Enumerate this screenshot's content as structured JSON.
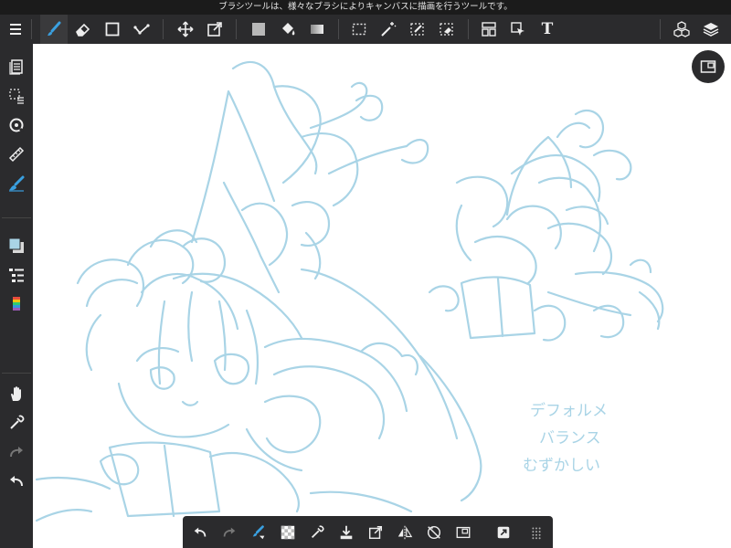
{
  "hint_bar": {
    "text": "ブラシツールは、様々なブラシによりキャンバスに描画を行うツールです。"
  },
  "toolbar": {
    "menu_icon": "menu-icon",
    "tools": [
      "brush-tool",
      "eraser-tool",
      "shape-tool",
      "correction-tool",
      "move-tool",
      "transform-tool",
      "fill-color",
      "bucket-tool",
      "gradation-tool",
      "selection-tool",
      "magic-wand-tool",
      "select-pen-tool",
      "select-eraser-tool",
      "frame-divider-tool",
      "operation-tool",
      "text-tool"
    ],
    "text_tool_label": "T",
    "right_icons": [
      "material-icon",
      "layers-icon"
    ]
  },
  "sidebar": {
    "items": [
      "page-manager-icon",
      "selection-layer-icon",
      "snap-icon",
      "ruler-icon",
      "brush-settings-icon",
      "color-icon",
      "layer-list-icon",
      "color-palette-icon",
      "hand-icon",
      "eyedropper-icon",
      "redo-icon",
      "undo-icon"
    ]
  },
  "canvas": {
    "handwritten_note": [
      "デフォルメ",
      "バランス",
      "むずかしい"
    ],
    "sketch_color": "#a9d4e6"
  },
  "bottom_bar": {
    "items": [
      "undo-icon",
      "redo-icon",
      "brush-size-icon",
      "transparent-color-icon",
      "eyedropper-icon",
      "save-icon",
      "export-icon",
      "flip-horizontal-icon",
      "rotate-reset-icon",
      "snap-toggle-icon",
      "canvas-fit-icon",
      "more-icon"
    ]
  },
  "colors": {
    "ui_dark": "#2b2b2d",
    "accent_blue": "#3aa0e0",
    "canvas": "#ffffff"
  }
}
